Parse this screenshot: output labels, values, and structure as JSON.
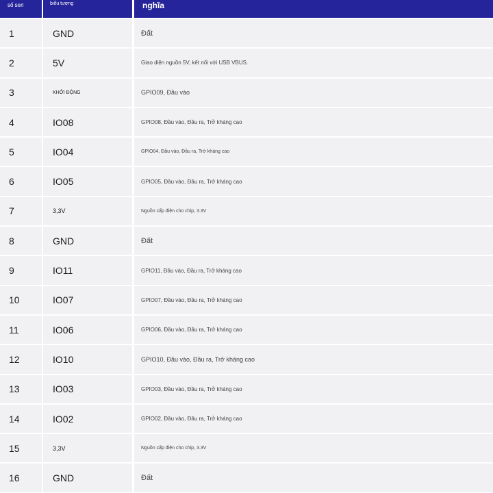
{
  "header": {
    "col1": "số seri",
    "col2": "biểu tượng",
    "col3": "nghĩa"
  },
  "rows": [
    {
      "no": "1",
      "symbol": "GND",
      "meaning": "Đất"
    },
    {
      "no": "2",
      "symbol": "5V",
      "meaning": "Giao diện nguồn 5V, kết nối với USB VBUS."
    },
    {
      "no": "3",
      "symbol": "KHỞI ĐỘNG",
      "meaning": "GPIO09, Đầu vào"
    },
    {
      "no": "4",
      "symbol": "IO08",
      "meaning": "GPIO08, Đầu vào, Đầu ra, Trở kháng cao"
    },
    {
      "no": "5",
      "symbol": "IO04",
      "meaning": "GPIO04, Đầu vào, Đầu ra, Trở kháng cao"
    },
    {
      "no": "6",
      "symbol": "IO05",
      "meaning": "GPIO05, Đầu vào, Đầu ra, Trở kháng cao"
    },
    {
      "no": "7",
      "symbol": "3,3V",
      "meaning": "Nguồn cấp điện cho chip, 3.3V"
    },
    {
      "no": "8",
      "symbol": "GND",
      "meaning": "Đất"
    },
    {
      "no": "9",
      "symbol": "IO11",
      "meaning": "GPIO11, Đầu vào, Đầu ra, Trở kháng cao"
    },
    {
      "no": "10",
      "symbol": "IO07",
      "meaning": "GPIO07, Đầu vào, Đầu ra, Trở kháng cao"
    },
    {
      "no": "11",
      "symbol": "IO06",
      "meaning": "GPIO06, Đầu vào, Đầu ra, Trở kháng cao"
    },
    {
      "no": "12",
      "symbol": "IO10",
      "meaning": "GPIO10, Đầu vào, Đầu ra, Trở kháng cao"
    },
    {
      "no": "13",
      "symbol": "IO03",
      "meaning": "GPIO03, Đầu vào, Đầu ra, Trở kháng cao"
    },
    {
      "no": "14",
      "symbol": "IO02",
      "meaning": "GPIO02, Đầu vào, Đầu ra, Trở kháng cao"
    },
    {
      "no": "15",
      "symbol": "3,3V",
      "meaning": "Nguồn cấp điện cho chip, 3.3V"
    },
    {
      "no": "16",
      "symbol": "GND",
      "meaning": "Đất"
    }
  ],
  "colors": {
    "header_bg": "#25249a",
    "row_bg": "#f1f1f4"
  }
}
